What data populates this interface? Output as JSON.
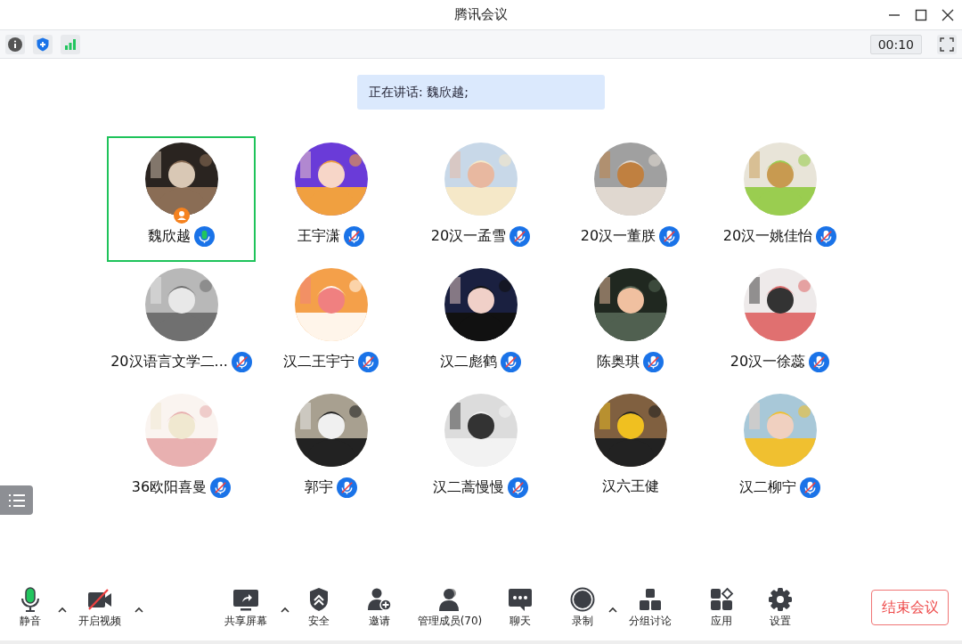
{
  "window": {
    "title": "腾讯会议"
  },
  "info_bar": {
    "timer": "00:10"
  },
  "speaking_banner": "正在讲话: 魏欣越;",
  "participants": [
    {
      "name": "魏欣越",
      "speaking": true,
      "muted": false,
      "selected": true,
      "host": true
    },
    {
      "name": "王宇潇",
      "speaking": false,
      "muted": true,
      "selected": false,
      "host": false
    },
    {
      "name": "20汉一孟雪",
      "speaking": false,
      "muted": true,
      "selected": false,
      "host": false
    },
    {
      "name": "20汉一董朕",
      "speaking": false,
      "muted": true,
      "selected": false,
      "host": false
    },
    {
      "name": "20汉一姚佳怡",
      "speaking": false,
      "muted": true,
      "selected": false,
      "host": false
    },
    {
      "name": "20汉语言文学二...",
      "speaking": false,
      "muted": true,
      "selected": false,
      "host": false
    },
    {
      "name": "汉二王宇宁",
      "speaking": false,
      "muted": true,
      "selected": false,
      "host": false
    },
    {
      "name": "汉二彪鹤",
      "speaking": false,
      "muted": true,
      "selected": false,
      "host": false
    },
    {
      "name": "陈奥琪",
      "speaking": false,
      "muted": true,
      "selected": false,
      "host": false
    },
    {
      "name": "20汉一徐蕊",
      "speaking": false,
      "muted": true,
      "selected": false,
      "host": false
    },
    {
      "name": "36欧阳喜曼",
      "speaking": false,
      "muted": true,
      "selected": false,
      "host": false
    },
    {
      "name": "郭宇",
      "speaking": false,
      "muted": true,
      "selected": false,
      "host": false
    },
    {
      "name": "汉二蒿慢慢",
      "speaking": false,
      "muted": true,
      "selected": false,
      "host": false
    },
    {
      "name": "汉六王健",
      "speaking": false,
      "muted": false,
      "selected": false,
      "host": false
    },
    {
      "name": "汉二柳宁",
      "speaking": false,
      "muted": true,
      "selected": false,
      "host": false
    }
  ],
  "toolbar_left": [
    {
      "kind": "mic",
      "label": "静音",
      "has_menu": true
    },
    {
      "kind": "video",
      "label": "开启视频",
      "has_menu": true
    }
  ],
  "toolbar_center": [
    {
      "kind": "share",
      "label": "共享屏幕",
      "has_menu": true
    },
    {
      "kind": "security",
      "label": "安全",
      "has_menu": false
    },
    {
      "kind": "invite",
      "label": "邀请",
      "has_menu": false
    },
    {
      "kind": "members",
      "label": "管理成员(70)",
      "has_menu": false
    },
    {
      "kind": "chat",
      "label": "聊天",
      "has_menu": false
    },
    {
      "kind": "record",
      "label": "录制",
      "has_menu": true
    },
    {
      "kind": "breakout",
      "label": "分组讨论",
      "has_menu": false
    },
    {
      "kind": "apps",
      "label": "应用",
      "has_menu": false
    },
    {
      "kind": "settings",
      "label": "设置",
      "has_menu": false
    }
  ],
  "end_button": "结束会议"
}
